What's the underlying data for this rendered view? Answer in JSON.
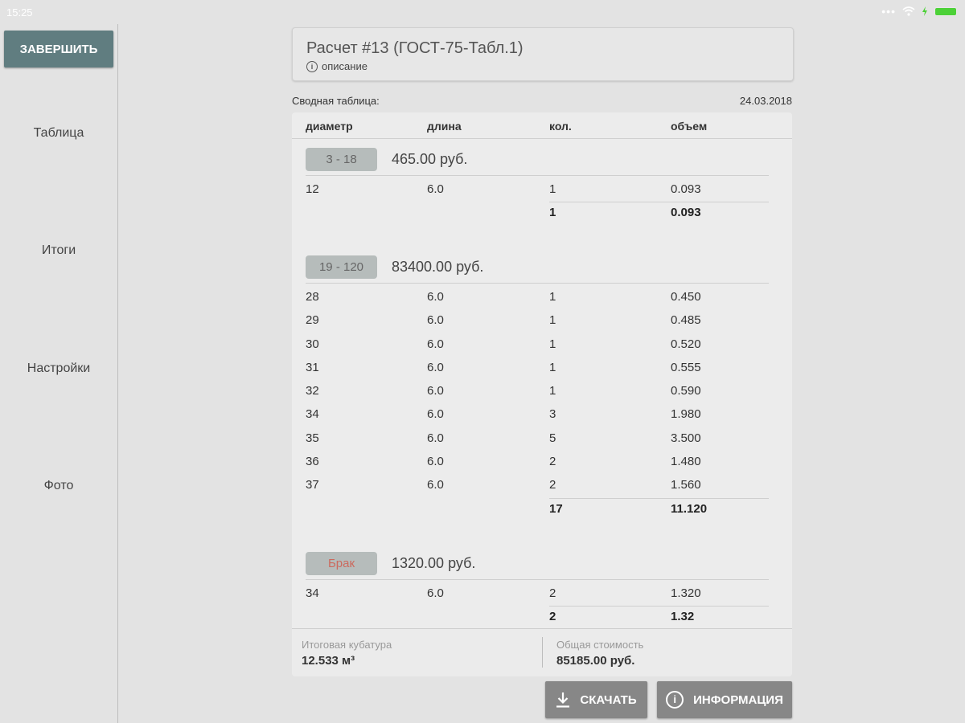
{
  "status_bar": {
    "time": "15:25"
  },
  "sidebar": {
    "finish_label": "ЗАВЕРШИТЬ",
    "items": [
      {
        "label": "Таблица"
      },
      {
        "label": "Итоги"
      },
      {
        "label": "Настройки"
      },
      {
        "label": "Фото"
      }
    ]
  },
  "header": {
    "title": "Расчет #13 (ГОСТ-75-Табл.1)",
    "description": "описание",
    "description_icon": "info-icon"
  },
  "summary": {
    "label": "Сводная таблица:",
    "date": "24.03.2018"
  },
  "table": {
    "columns": [
      "диаметр",
      "длина",
      "кол.",
      "объем"
    ],
    "groups": [
      {
        "range": "3 - 18",
        "price": "465.00 руб.",
        "rows": [
          [
            "12",
            "6.0",
            "1",
            "0.093"
          ]
        ],
        "total_count": "1",
        "total_volume": "0.093"
      },
      {
        "range": "19 - 120",
        "price": "83400.00 руб.",
        "rows": [
          [
            "28",
            "6.0",
            "1",
            "0.450"
          ],
          [
            "29",
            "6.0",
            "1",
            "0.485"
          ],
          [
            "30",
            "6.0",
            "1",
            "0.520"
          ],
          [
            "31",
            "6.0",
            "1",
            "0.555"
          ],
          [
            "32",
            "6.0",
            "1",
            "0.590"
          ],
          [
            "34",
            "6.0",
            "3",
            "1.980"
          ],
          [
            "35",
            "6.0",
            "5",
            "3.500"
          ],
          [
            "36",
            "6.0",
            "2",
            "1.480"
          ],
          [
            "37",
            "6.0",
            "2",
            "1.560"
          ]
        ],
        "total_count": "17",
        "total_volume": "11.120"
      },
      {
        "range": "Брак",
        "price": "1320.00 руб.",
        "rows": [
          [
            "34",
            "6.0",
            "2",
            "1.320"
          ]
        ],
        "total_count": "2",
        "total_volume": "1.32"
      }
    ]
  },
  "footer": {
    "volume_label": "Итоговая кубатура",
    "volume_value": "12.533 м³",
    "cost_label": "Общая стоимость",
    "cost_value": "85185.00 руб."
  },
  "actions": {
    "download_label": "СКАЧАТЬ",
    "download_icon": "download-icon",
    "info_label": "ИНФОРМАЦИЯ",
    "info_icon": "info-icon"
  },
  "colors": {
    "accent": "#607d80",
    "chip": "#b6bcbb",
    "defect_text": "#cc6a5e",
    "button": "#878787"
  }
}
